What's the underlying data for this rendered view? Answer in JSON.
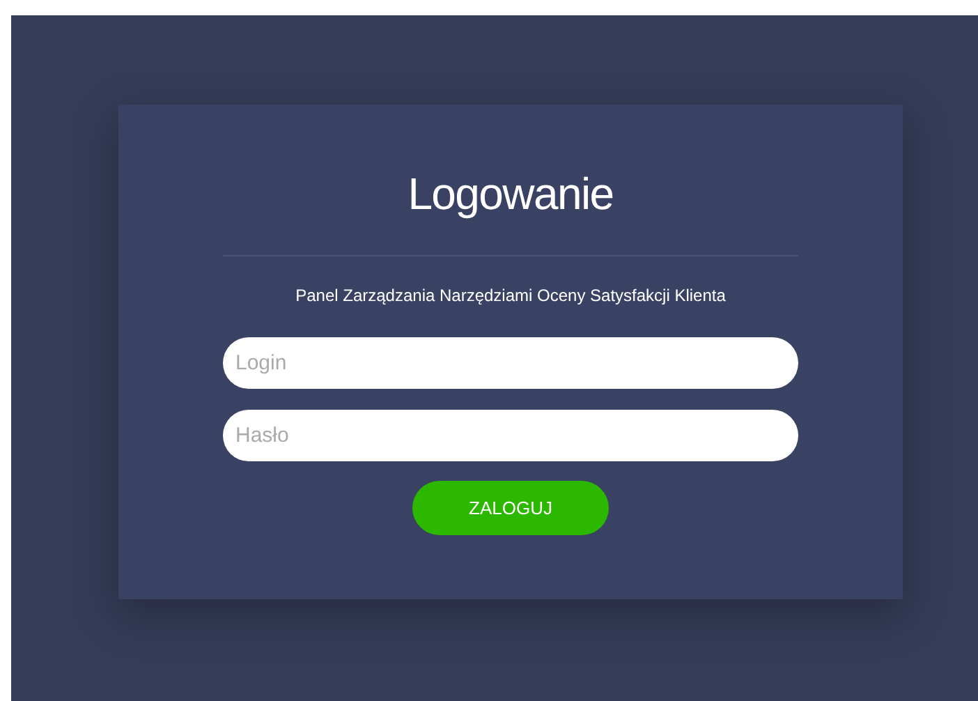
{
  "login_card": {
    "title": "Logowanie",
    "subtitle": "Panel Zarządzania Narzędziami Oceny Satysfakcji Klienta",
    "fields": [
      {
        "placeholder": "Login"
      },
      {
        "placeholder": "Hasło"
      }
    ],
    "submit_button": "ZALOGUJ"
  }
}
